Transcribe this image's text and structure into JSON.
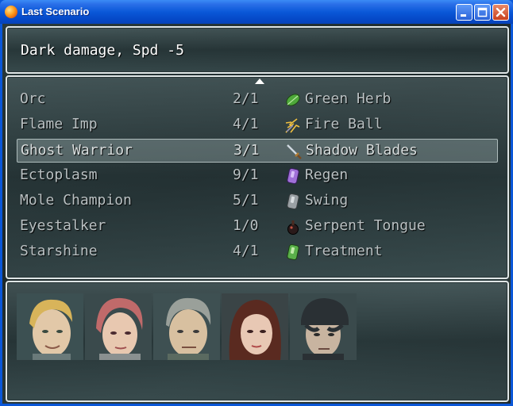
{
  "window": {
    "title": "Last Scenario",
    "app_icon": "orb-icon",
    "controls": [
      "minimize",
      "maximize",
      "close"
    ]
  },
  "help": {
    "text": "Dark damage, Spd -5"
  },
  "list": {
    "rows": [
      {
        "name": "Orc",
        "count": "2/1",
        "skill": "Green Herb",
        "icon": "herb-leaf-icon"
      },
      {
        "name": "Flame Imp",
        "count": "4/1",
        "skill": "Fire Ball",
        "icon": "fire-spark-icon"
      },
      {
        "name": "Ghost Warrior",
        "count": "3/1",
        "skill": "Shadow Blades",
        "icon": "sword-icon",
        "selected": true
      },
      {
        "name": "Ectoplasm",
        "count": "9/1",
        "skill": "Regen",
        "icon": "purple-gem-icon"
      },
      {
        "name": "Mole Champion",
        "count": "5/1",
        "skill": "Swing",
        "icon": "gray-gem-icon"
      },
      {
        "name": "Eyestalker",
        "count": "1/0",
        "skill": "Serpent Tongue",
        "icon": "bottle-icon"
      },
      {
        "name": "Starshine",
        "count": "4/1",
        "skill": "Treatment",
        "icon": "green-gem-icon"
      }
    ]
  },
  "party": {
    "members": [
      {
        "icon": "portrait-blond-man"
      },
      {
        "icon": "portrait-red-haired-woman"
      },
      {
        "icon": "portrait-gray-haired-man"
      },
      {
        "icon": "portrait-dark-haired-woman"
      },
      {
        "icon": "portrait-capped-man"
      }
    ]
  }
}
